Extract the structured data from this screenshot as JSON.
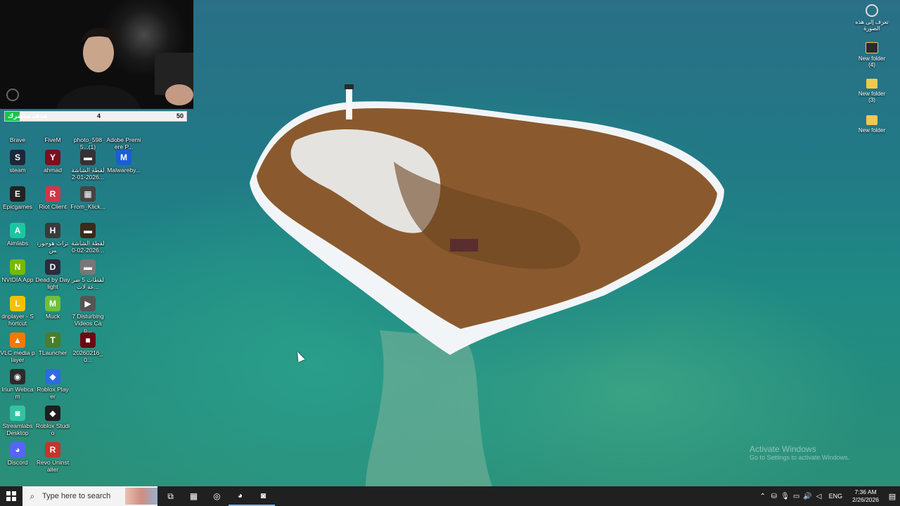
{
  "webcam": {
    "goal": {
      "label": "هدف مشترك",
      "current": "4",
      "target": "50",
      "progress": 0.08
    }
  },
  "desktop": {
    "left_icons": [
      {
        "name": "brave",
        "label": "Brave",
        "icon": "brave-icon",
        "color": "#fb542b",
        "glyph": "B"
      },
      {
        "name": "fivem",
        "label": "FiveM",
        "icon": "fivem-icon",
        "color": "#f28a30",
        "glyph": "F"
      },
      {
        "name": "photo",
        "label": "photo_5985...(1)",
        "icon": "photo-icon",
        "color": "#6c6c6c",
        "glyph": "▣"
      },
      {
        "name": "premiere",
        "label": "Adobe Premiere P...",
        "icon": "premiere-icon",
        "color": "#2a1a5e",
        "glyph": "Pr"
      },
      {
        "name": "steam",
        "label": "steam",
        "icon": "steam-icon",
        "color": "#1b2838",
        "glyph": "S"
      },
      {
        "name": "ahmad",
        "label": "ahmad",
        "icon": "user-file-icon",
        "color": "#7a1020",
        "glyph": "Y"
      },
      {
        "name": "screenshot1",
        "label": "لقطة الشاشة 2026-01-2...",
        "icon": "image-file-icon",
        "color": "#333333",
        "glyph": "▬"
      },
      {
        "name": "malwarebytes",
        "label": "Malwareby...",
        "icon": "malwarebytes-icon",
        "color": "#1a5dd6",
        "glyph": "M"
      },
      {
        "name": "epic",
        "label": "Epicgames",
        "icon": "epic-games-icon",
        "color": "#222222",
        "glyph": "E"
      },
      {
        "name": "riot",
        "label": "Riot Client",
        "icon": "riot-icon",
        "color": "#d1364a",
        "glyph": "R"
      },
      {
        "name": "from-klick",
        "label": "From_Klick...",
        "icon": "file-icon",
        "color": "#444444",
        "glyph": "▦"
      },
      {
        "name": "aimlabs",
        "label": "Aimlabs",
        "icon": "aimlabs-icon",
        "color": "#1cc6a0",
        "glyph": "A"
      },
      {
        "name": "hogwarts",
        "label": "تراث هوجورتس",
        "icon": "hogwarts-icon",
        "color": "#3a3a3a",
        "glyph": "H"
      },
      {
        "name": "screenshot2",
        "label": "لقطة الشاشة 2026-02-0...",
        "icon": "image-file-icon",
        "color": "#3a2a1a",
        "glyph": "▬"
      },
      {
        "name": "nvidia",
        "label": "NVIDIA App",
        "icon": "nvidia-icon",
        "color": "#76b900",
        "glyph": "N"
      },
      {
        "name": "dbd",
        "label": "Dead by Daylight",
        "icon": "dbd-icon",
        "color": "#2c2c3c",
        "glyph": "D"
      },
      {
        "name": "clips5",
        "label": "لقطات 5 ضرعة لات...",
        "icon": "image-file-icon",
        "color": "#777777",
        "glyph": "▬"
      },
      {
        "name": "ldplayer",
        "label": "dnplayer - Shortcut",
        "icon": "ldplayer-icon",
        "color": "#f2c200",
        "glyph": "L"
      },
      {
        "name": "muck",
        "label": "Muck",
        "icon": "muck-icon",
        "color": "#6fbf3a",
        "glyph": "M"
      },
      {
        "name": "disturbing",
        "label": "7 Disturbing Videos Cap...",
        "icon": "video-file-icon",
        "color": "#555555",
        "glyph": "▶"
      },
      {
        "name": "vlc",
        "label": "VLC media player",
        "icon": "vlc-icon",
        "color": "#f27a00",
        "glyph": "▲"
      },
      {
        "name": "tlauncher",
        "label": "TLauncher",
        "icon": "tlauncher-icon",
        "color": "#4b7d2b",
        "glyph": "T"
      },
      {
        "name": "video-file",
        "label": "20260216_0...",
        "icon": "video-file-icon",
        "color": "#6a0a12",
        "glyph": "■"
      },
      {
        "name": "iriun",
        "label": "Iriun Webcam",
        "icon": "iriun-icon",
        "color": "#2b2b2b",
        "glyph": "◉"
      },
      {
        "name": "roblox-player",
        "label": "Roblox Player",
        "icon": "roblox-icon",
        "color": "#2d6cdf",
        "glyph": "◆"
      },
      {
        "name": "streamlabs",
        "label": "Streamlabs Desktop",
        "icon": "streamlabs-icon",
        "color": "#31c3a2",
        "glyph": "◙"
      },
      {
        "name": "roblox-studio",
        "label": "Roblox Studio",
        "icon": "roblox-studio-icon",
        "color": "#1e1e1e",
        "glyph": "◆"
      },
      {
        "name": "discord",
        "label": "Discord",
        "icon": "discord-icon",
        "color": "#5865f2",
        "glyph": "◕"
      },
      {
        "name": "revo",
        "label": "Revo Uninstaller",
        "icon": "revo-icon",
        "color": "#c4342c",
        "glyph": "R"
      }
    ],
    "right_icons": [
      {
        "name": "arabic-item",
        "label": "تعرف إلى هذه الصورة",
        "icon": "camera-icon",
        "style": "circle"
      },
      {
        "name": "new-folder-4",
        "label": "New folder (4)",
        "icon": "folder-icon",
        "style": "dark"
      },
      {
        "name": "new-folder-3",
        "label": "New folder (3)",
        "icon": "folder-icon",
        "style": "yellow"
      },
      {
        "name": "new-folder",
        "label": "New folder",
        "icon": "folder-icon",
        "style": "yellow"
      }
    ],
    "watermark": {
      "title": "Activate Windows",
      "subtitle": "Go to Settings to activate Windows."
    }
  },
  "taskbar": {
    "search_placeholder": "Type here to search",
    "pinned": [
      {
        "name": "task-view",
        "icon": "task-view-icon",
        "glyph": "⧉"
      },
      {
        "name": "store",
        "icon": "store-icon",
        "glyph": "▦"
      },
      {
        "name": "chrome",
        "icon": "chrome-icon",
        "glyph": "◎"
      },
      {
        "name": "discord-tb",
        "icon": "discord-icon",
        "glyph": "◕",
        "active": true
      },
      {
        "name": "streamlabs-tb",
        "icon": "streamlabs-icon",
        "glyph": "◙",
        "active": true
      }
    ],
    "tray": {
      "language": "ENG",
      "time": "7:36 AM",
      "date": "2/26/2026"
    }
  }
}
